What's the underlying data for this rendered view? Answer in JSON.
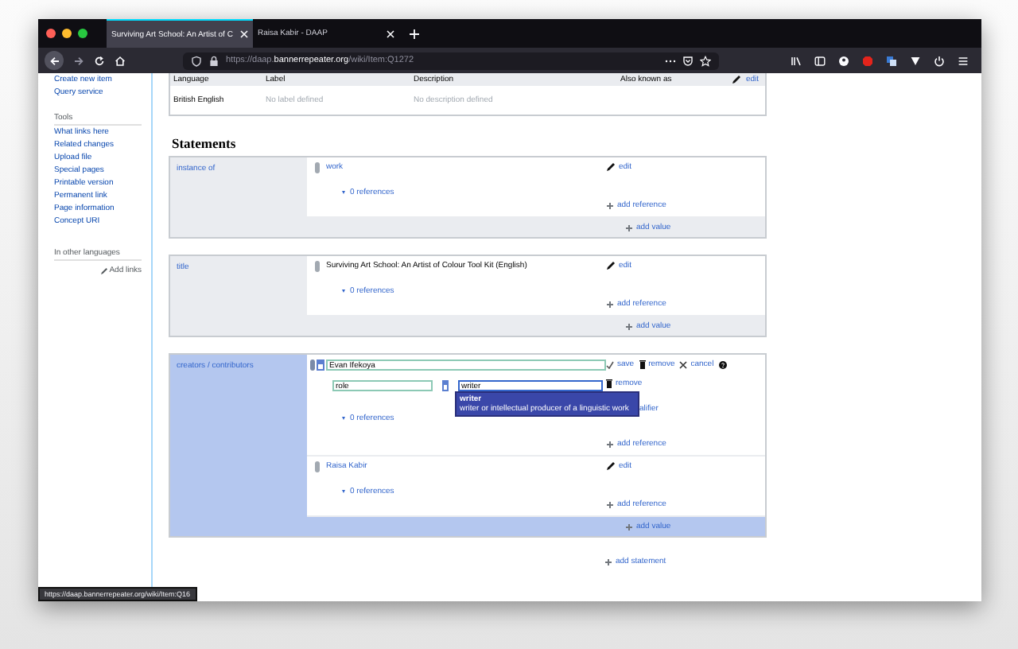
{
  "tabs": [
    {
      "title": "Surviving Art School: An Artist of C",
      "selected": true
    },
    {
      "title": "Raisa Kabir - DAAP",
      "selected": false
    }
  ],
  "address_bar": {
    "url": "https://daap.**bannerrepeater.org**/wiki/Item:Q1272"
  },
  "sidebar": {
    "top_items": [
      "Create new item",
      "Query service"
    ],
    "sections": [
      {
        "heading": "Tools",
        "items": [
          "What links here",
          "Related changes",
          "Upload file",
          "Special pages",
          "Printable version",
          "Permanent link",
          "Page information",
          "Concept URI"
        ]
      },
      {
        "heading": "In other languages"
      }
    ],
    "add_links": "Add links"
  },
  "terms_table": {
    "columns": [
      "Language",
      "Label",
      "Description",
      "Also known as"
    ],
    "edit": "edit",
    "rows": [
      {
        "cells": [
          {
            "text": "British English",
            "missing": false
          },
          {
            "text": "No label defined",
            "missing": true
          },
          {
            "text": "No description defined",
            "missing": true
          }
        ]
      }
    ]
  },
  "statements": {
    "heading": "Statements",
    "add_statement": "add statement",
    "groups": [
      {
        "property": "instance of",
        "editing": false,
        "add_value": "add value",
        "values": [
          {
            "kind": "view",
            "value": "work",
            "linked": true,
            "edit": "edit",
            "references": "0 references",
            "add_reference": "add reference"
          }
        ]
      },
      {
        "property": "title",
        "editing": false,
        "add_value": "add value",
        "values": [
          {
            "kind": "view",
            "value": "Surviving Art School: An Artist of Colour Tool Kit (English)",
            "linked": false,
            "edit": "edit",
            "references": "0 references",
            "add_reference": "add reference"
          }
        ]
      },
      {
        "property": "creators / contributors",
        "editing": true,
        "add_value": "add value",
        "values": [
          {
            "kind": "edit",
            "value": "Evan Ifekoya",
            "save": "save",
            "remove": "remove",
            "cancel": "cancel",
            "qualifiers": [
              {
                "property": "role",
                "value": "writer",
                "remove": "remove"
              }
            ],
            "suggestion": {
              "label": "writer",
              "description": "writer or intellectual producer of a linguistic work"
            },
            "add_qualifier": "alifier",
            "references": "0 references",
            "add_reference": "add reference"
          },
          {
            "kind": "view",
            "value": "Raisa Kabir",
            "linked": true,
            "edit": "edit",
            "references": "0 references",
            "add_reference": "add reference"
          }
        ]
      }
    ]
  },
  "status_bar": {
    "link": "https://daap.bannerrepeater.org/wiki/Item:Q16"
  }
}
